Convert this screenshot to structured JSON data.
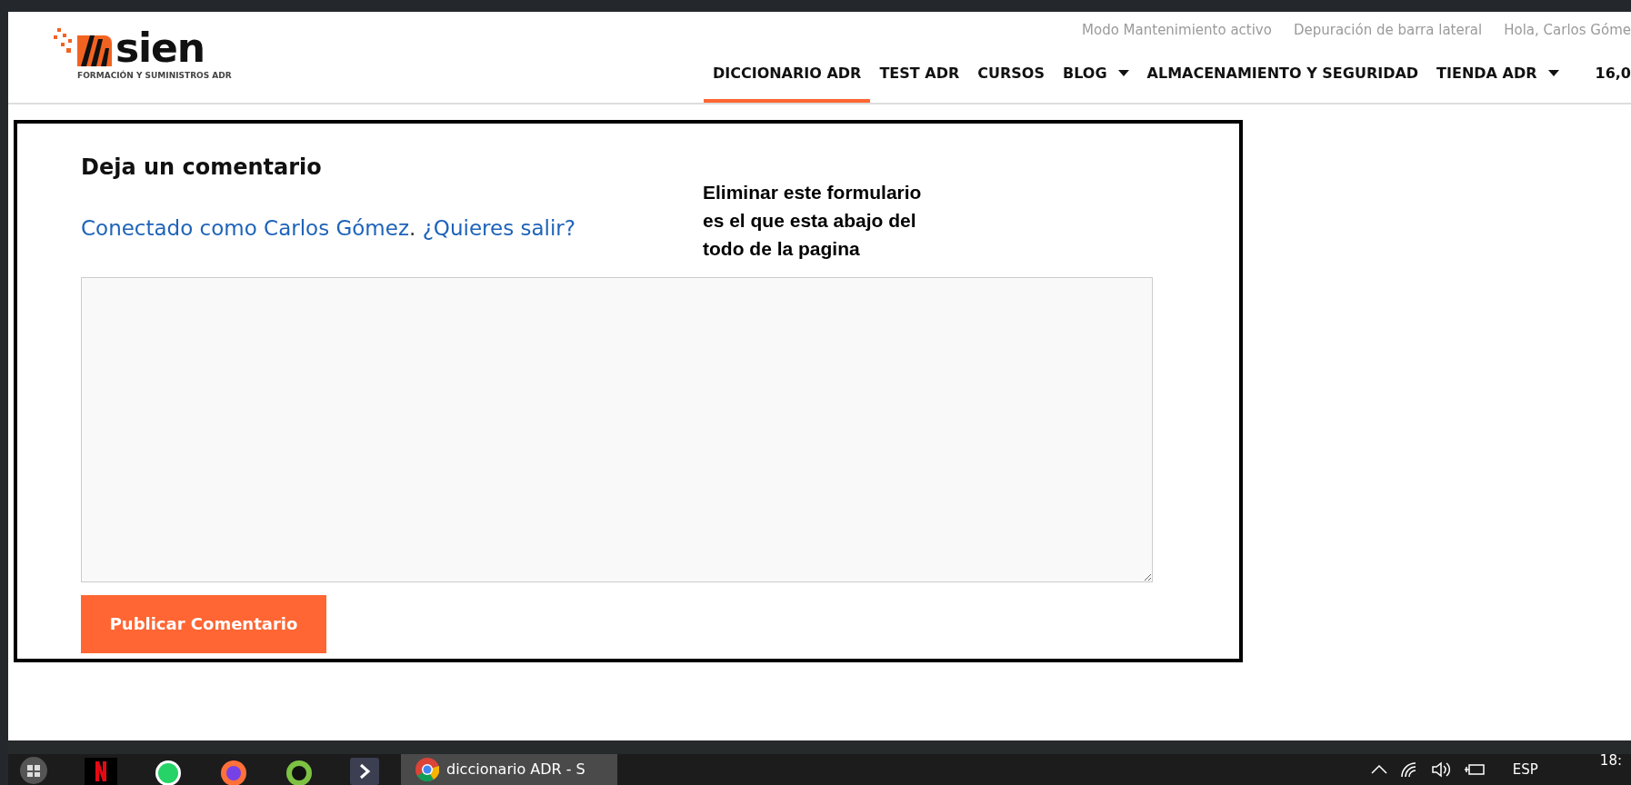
{
  "site_header": {
    "logo": {
      "wordmark": "sien",
      "tagline": "FORMACIÓN Y SUMINISTROS ADR"
    },
    "admin_links": [
      "Modo Mantenimiento activo",
      "Depuración de barra lateral",
      "Hola, Carlos Góme"
    ],
    "nav": [
      {
        "label": "DICCIONARIO ADR",
        "selected": true,
        "dropdown": false
      },
      {
        "label": "TEST ADR",
        "selected": false,
        "dropdown": false
      },
      {
        "label": "CURSOS",
        "selected": false,
        "dropdown": false
      },
      {
        "label": "BLOG",
        "selected": false,
        "dropdown": true
      },
      {
        "label": "ALMACENAMIENTO Y SEGURIDAD",
        "selected": false,
        "dropdown": false
      },
      {
        "label": "TIENDA ADR",
        "selected": false,
        "dropdown": true
      }
    ],
    "cart_total": "16,0"
  },
  "comment_form": {
    "title": "Deja un comentario",
    "logged_in_prefix": "Conectado como Carlos Gómez",
    "separator": ".",
    "logout_link": "¿Quieres salir?",
    "submit": "Publicar Comentario"
  },
  "annotation": [
    "Eliminar este formulario",
    "es el que esta abajo del",
    "todo de la pagina"
  ],
  "taskbar": {
    "active_window": "diccionario ADR - S",
    "language": "ESP",
    "clock": "18:"
  }
}
